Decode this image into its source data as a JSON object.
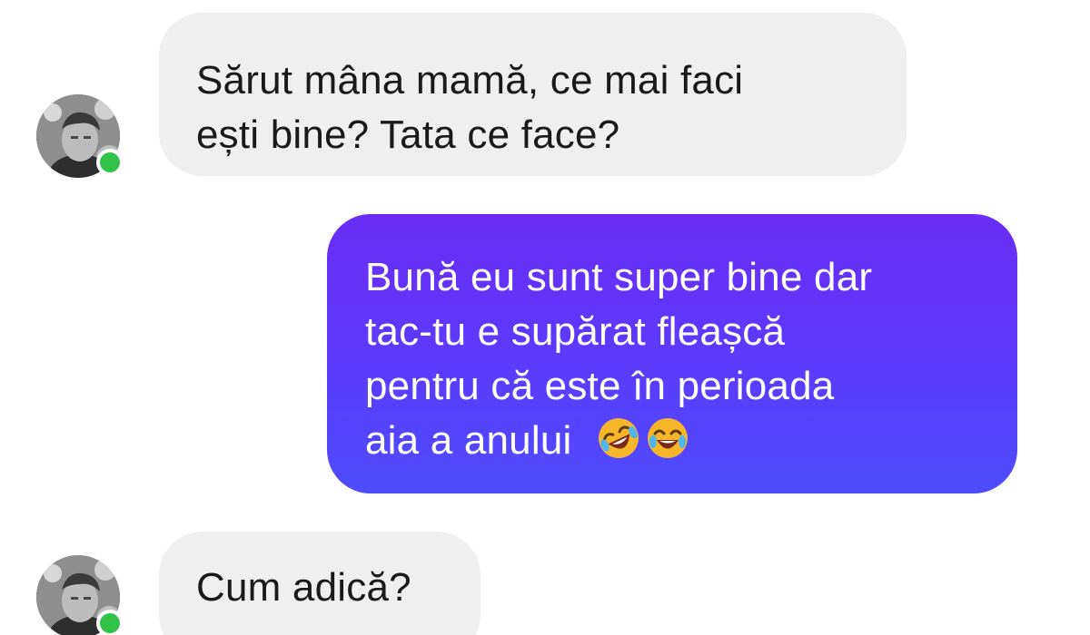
{
  "messages": [
    {
      "sender": "contact",
      "lines": [
        "Sărut mâna mamă, ce mai faci",
        "ești bine? Tata ce face?"
      ]
    },
    {
      "sender": "me",
      "lines": [
        "Bună eu sunt super bine dar",
        "tac-tu e supărat fleașcă",
        "pentru că este în perioada",
        "aia a anului"
      ],
      "emojis": [
        "rolling-on-floor-laughing-emoji",
        "tears-of-joy-emoji"
      ]
    },
    {
      "sender": "contact",
      "lines": [
        "Cum adică?"
      ]
    }
  ],
  "contact": {
    "online": true,
    "status_color": "#31c24a"
  },
  "colors": {
    "incoming_bubble": "#efefef",
    "outgoing_bubble_top": "#6a2cf5",
    "outgoing_bubble_bottom": "#4d4dff",
    "text_dark": "#1a1a1a",
    "text_light": "#ffffff"
  }
}
